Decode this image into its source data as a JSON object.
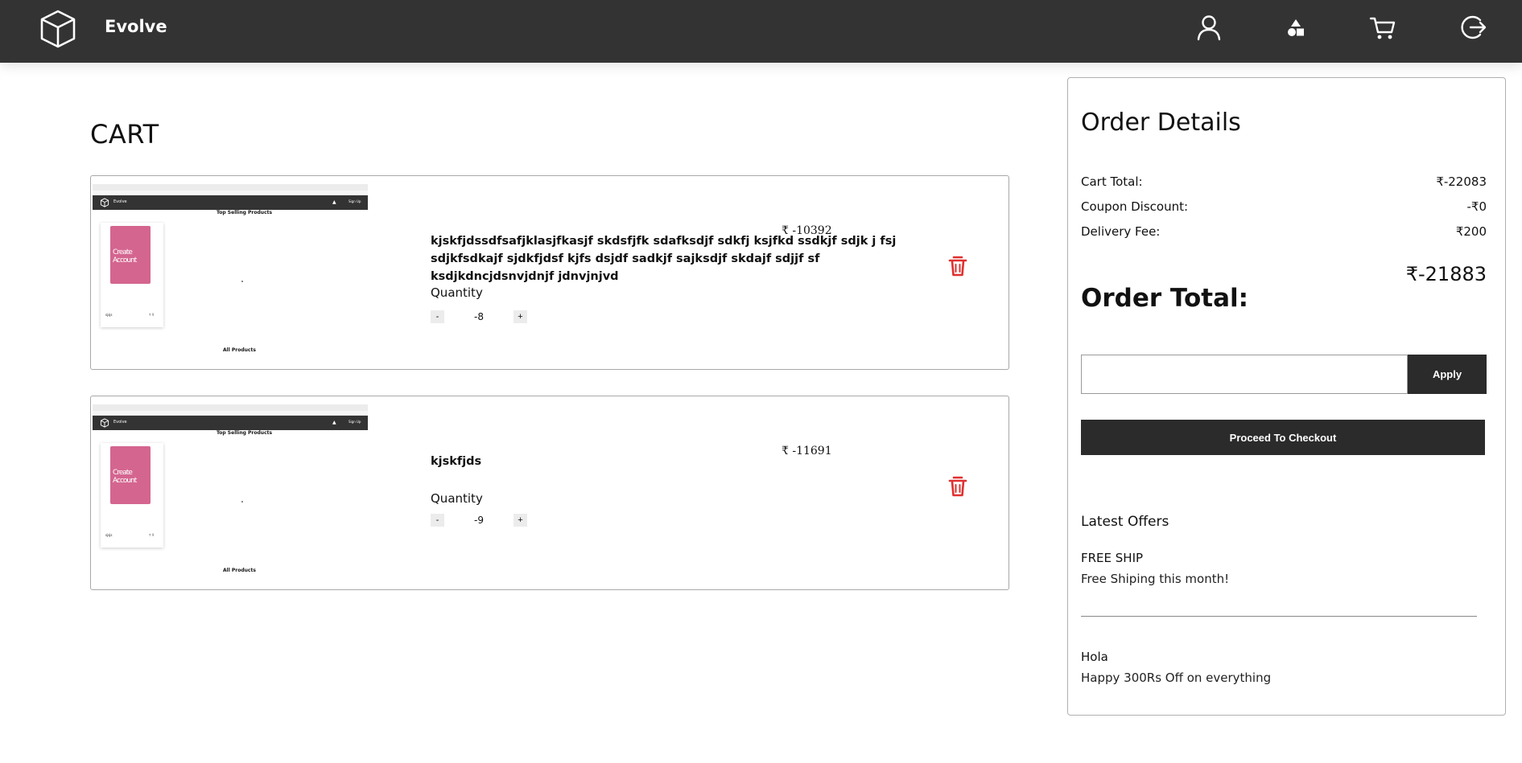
{
  "navbar": {
    "brand": "Evolve",
    "icons": [
      "user-icon",
      "shapes-icon",
      "cart-icon",
      "logout-icon"
    ]
  },
  "cart": {
    "title": "CART",
    "items": [
      {
        "name": "kjskfjdssdfsafjklasjfkasjf skdsfjfk sdafksdjf sdkfj ksjfkd ssdkjf sdjk j fsj sdjkfsdkajf sjdkfjdsf kjfs dsjdf sadkjf sajksdjf skdajf sdjjf sf ksdjkdncjdsnvjdnjf jdnvjnjvd",
        "price": "₹ -10392",
        "quantity_label": "Quantity",
        "quantity": "-8",
        "thumbnail": {
          "brand": "Evolve",
          "heading": "Top Selling Products",
          "card_button": "Create Account",
          "footer": "All Products",
          "signin": "Sign Up"
        }
      },
      {
        "name": "kjskfjds",
        "price": "₹ -11691",
        "quantity_label": "Quantity",
        "quantity": "-9",
        "thumbnail": {
          "brand": "Evolve",
          "heading": "Top Selling Products",
          "card_button": "Create Account",
          "footer": "All Products",
          "signin": "Sign Up"
        }
      }
    ],
    "minus_label": "-",
    "plus_label": "+"
  },
  "order": {
    "title": "Order Details",
    "cart_total_label": "Cart Total:",
    "cart_total_value": "₹-22083",
    "coupon_label": "Coupon Discount:",
    "coupon_value": "-₹0",
    "delivery_label": "Delivery Fee:",
    "delivery_value": "₹200",
    "order_total_label": "Order Total:",
    "order_total_value": "₹-21883",
    "coupon_input_value": "",
    "apply_label": "Apply",
    "checkout_label": "Proceed To Checkout",
    "offers_title": "Latest Offers",
    "offers": [
      {
        "code": "FREE SHIP",
        "description": "Free Shiping this month!"
      },
      {
        "code": "Hola",
        "description": "Happy 300Rs Off on everything"
      }
    ]
  },
  "colors": {
    "navbar": "#333333",
    "button": "#2b2b2b",
    "trash": "#e03030",
    "thumb_pink": "#d4658f"
  }
}
